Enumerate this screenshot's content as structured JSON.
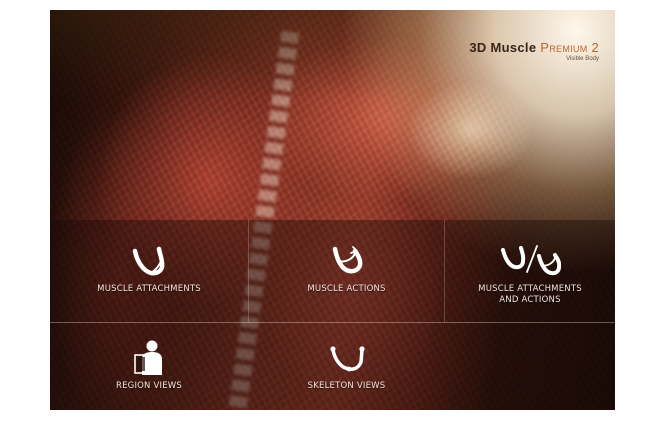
{
  "logo": {
    "title_main": "3D Muscle",
    "title_accent": "Premium 2",
    "subtitle": "Visible Body"
  },
  "menu": {
    "items": [
      {
        "label": "MUSCLE ATTACHMENTS",
        "icon": "arm-attachments-icon"
      },
      {
        "label": "MUSCLE ACTIONS",
        "icon": "arm-actions-icon"
      },
      {
        "label": "MUSCLE ATTACHMENTS\nAND ACTIONS",
        "icon": "arm-attachments-actions-icon"
      },
      {
        "label": "REGION VIEWS",
        "icon": "body-region-icon"
      },
      {
        "label": "SKELETON VIEWS",
        "icon": "arm-skeleton-icon"
      }
    ]
  },
  "colors": {
    "label": "#f1e6dc",
    "logo_dark": "#3a2418",
    "logo_accent": "#b8662e",
    "icon_white": "#ffffff"
  }
}
